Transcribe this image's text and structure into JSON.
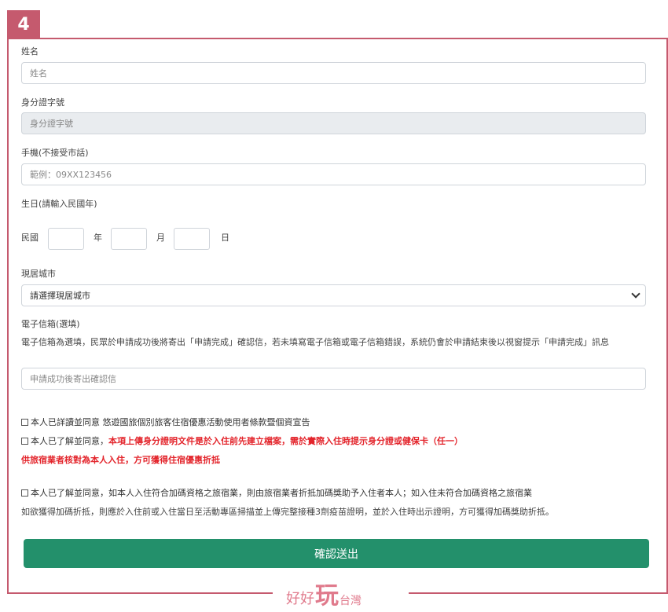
{
  "step": "4",
  "fields": {
    "name": {
      "label": "姓名",
      "placeholder": "姓名"
    },
    "id_number": {
      "label": "身分證字號",
      "placeholder": "身分證字號"
    },
    "phone": {
      "label": "手機(不接受市話)",
      "placeholder": "範例：09XX123456"
    },
    "birthday": {
      "label": "生日(請輸入民國年)",
      "era": "民國",
      "year": "年",
      "month": "月",
      "day": "日"
    },
    "city": {
      "label": "現居城市",
      "selected": "請選擇現居城市"
    },
    "email": {
      "label": "電子信箱(選填)",
      "note": "電子信箱為選填，民眾於申請成功後將寄出「申請完成」確認信，若未填寫電子信箱或電子信箱錯誤，系統仍會於申請結束後以視窗提示「申請完成」訊息",
      "placeholder": "申請成功後寄出確認信"
    }
  },
  "agreements": {
    "a1": "本人已詳讀並同意 悠遊國旅個別旅客住宿優惠活動使用者條款暨個資宣告",
    "a2_prefix": "本人已了解並同意，",
    "a2_red": "本項上傳身分證明文件是於入住前先建立檔案，需於實際入住時提示身分證或健保卡（任一）",
    "a2_red_line2": "供旅宿業者核對為本人入住，方可獲得住宿優惠折抵",
    "a3": "本人已了解並同意，如本人入住符合加碼資格之旅宿業，則由旅宿業者折抵加碼獎助予入住者本人；如入住未符合加碼資格之旅宿業",
    "a3_line2": "如欲獲得加碼折抵，則應於入住前或入住當日至活動專區掃描並上傳完整接種3劑疫苗證明，並於入住時出示證明，方可獲得加碼獎助折抵。"
  },
  "submit_label": "確認送出",
  "logo": {
    "part1": "好好",
    "part2": "玩",
    "part3": "台灣"
  },
  "colors": {
    "accent": "#c55a6e",
    "button": "#23906b",
    "warning": "#e3242b"
  }
}
